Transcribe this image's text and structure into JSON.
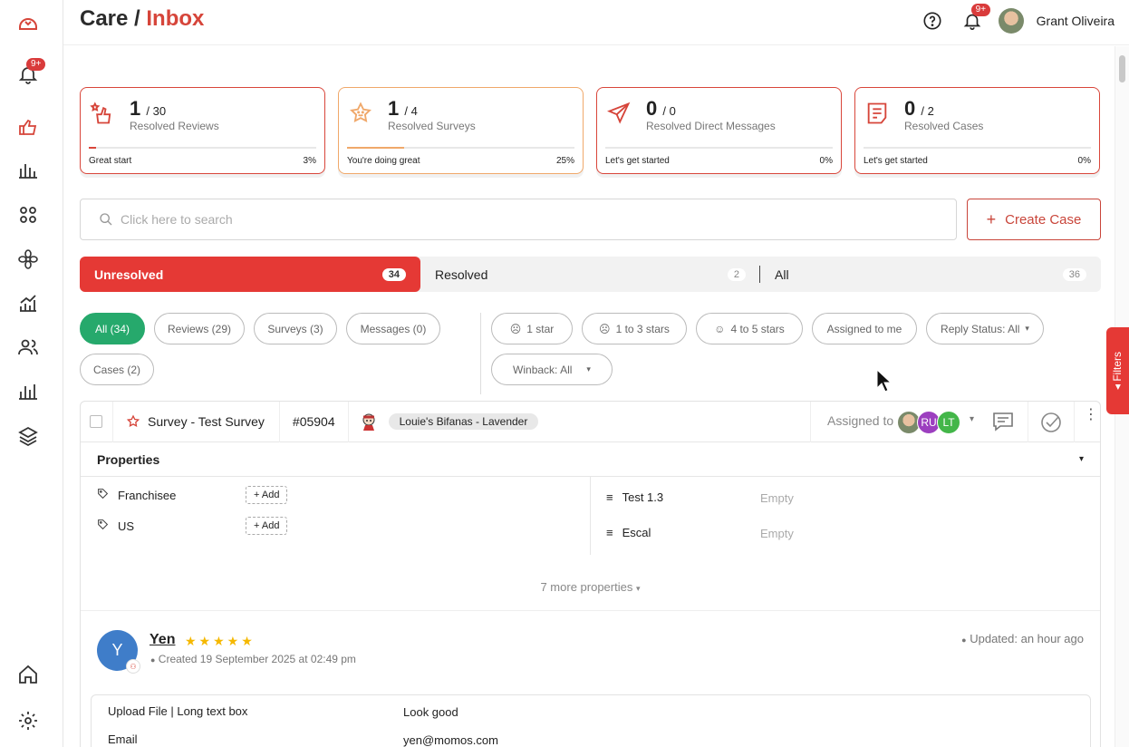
{
  "sidebar": {
    "notification_badge": "9+",
    "icons": [
      "logo-icon",
      "bell-icon",
      "care-icon",
      "bar-chart-icon",
      "apps-icon",
      "flower-icon",
      "growth-chart-icon",
      "users-icon",
      "analytics-icon",
      "layers-icon",
      "home-icon",
      "settings-icon"
    ]
  },
  "header": {
    "title_prefix": "Care /",
    "title_accent": "Inbox",
    "notification_badge": "9+",
    "user_name": "Grant Oliveira"
  },
  "stats": [
    {
      "value": "1",
      "total": "/ 30",
      "label": "Resolved Reviews",
      "status": "Great start",
      "percent_label": "3%",
      "progress": 0.03
    },
    {
      "value": "1",
      "total": "/ 4",
      "label": "Resolved Surveys",
      "status": "You're doing great",
      "percent_label": "25%",
      "progress": 0.25
    },
    {
      "value": "0",
      "total": "/ 0",
      "label": "Resolved Direct Messages",
      "status": "Let's get started",
      "percent_label": "0%",
      "progress": 0
    },
    {
      "value": "0",
      "total": "/ 2",
      "label": "Resolved Cases",
      "status": "Let's get started",
      "percent_label": "0%",
      "progress": 0
    }
  ],
  "search": {
    "placeholder": "Click here to search"
  },
  "create_case": {
    "label": "Create Case"
  },
  "tabs": [
    {
      "label": "Unresolved",
      "count": "34"
    },
    {
      "label": "Resolved",
      "count": "2"
    },
    {
      "label": "All",
      "count": "36"
    }
  ],
  "type_chips": [
    "All (34)",
    "Reviews (29)",
    "Surveys (3)",
    "Messages (0)",
    "Cases (2)"
  ],
  "filter_chips": [
    "1 star",
    "1 to 3 stars",
    "4 to 5 stars",
    "Assigned to me",
    "Reply Status: All",
    "Winback: All"
  ],
  "filters_tab": "Filters",
  "card": {
    "source": "Survey - Test Survey",
    "id": "#05904",
    "location": "Louie's Bifanas - Lavender",
    "assigned_label": "Assigned to",
    "assignees": [
      {
        "initials": "",
        "color": "#8a7a60"
      },
      {
        "initials": "RU",
        "color": "#9c3fbf"
      },
      {
        "initials": "LT",
        "color": "#43b649"
      }
    ],
    "properties_title": "Properties",
    "properties_left": [
      {
        "label": "Franchisee",
        "action": "+ Add"
      },
      {
        "label": "US",
        "action": "+ Add"
      }
    ],
    "properties_right": [
      {
        "label": "Test 1.3",
        "value": "Empty"
      },
      {
        "label": "Escal",
        "value": "Empty"
      }
    ],
    "more_properties": "7 more properties",
    "respondent": {
      "initial": "Y",
      "name": "Yen",
      "stars": "★★★★★",
      "rating": 5,
      "created": "Created 19 September 2025 at 02:49 pm",
      "updated": "Updated: an hour ago"
    },
    "answers": [
      {
        "question": "Upload File | Long text box",
        "answer": "Look good"
      },
      {
        "question": "Email",
        "answer": "yen@momos.com"
      }
    ]
  },
  "colors": {
    "accent": "#e53935",
    "brand": "#d6453a",
    "success": "#26a96c",
    "survey": "#f0a86a"
  }
}
